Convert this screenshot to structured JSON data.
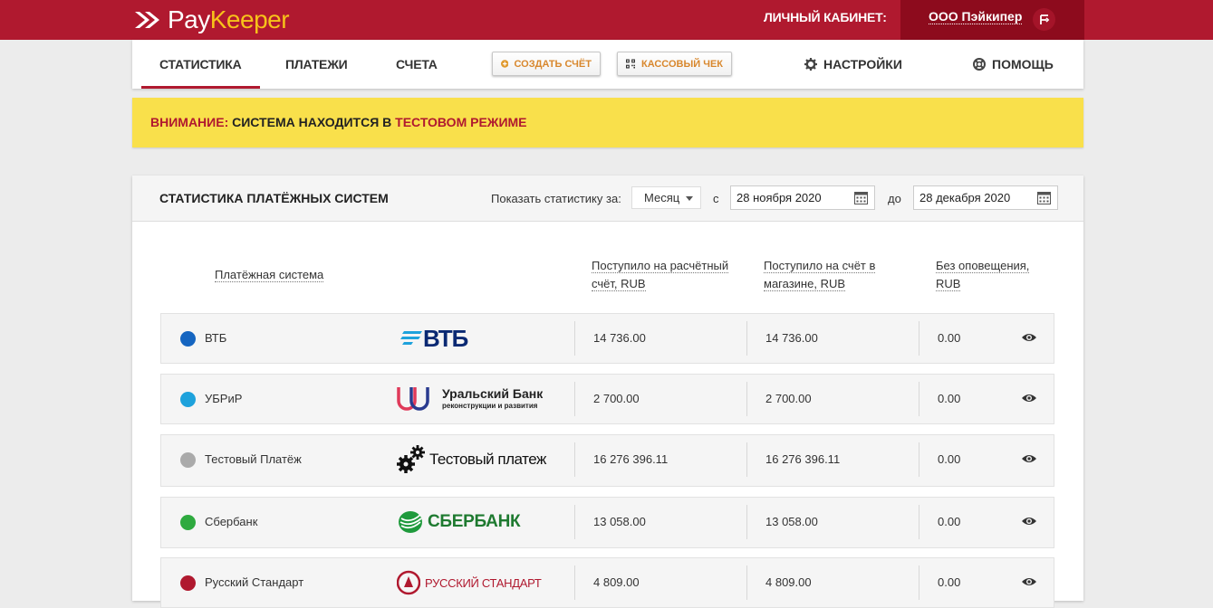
{
  "header": {
    "logo_pay": "Pay",
    "logo_keeper": "Keeper",
    "cabinet_label": "ЛИЧНЫЙ КАБИНЕТ:",
    "account_name": "ООО Пэйкипер"
  },
  "nav": {
    "tabs": [
      {
        "label": "СТАТИСТИКА",
        "active": true
      },
      {
        "label": "ПЛАТЕЖИ",
        "active": false
      },
      {
        "label": "СЧЕТА",
        "active": false
      }
    ],
    "create_invoice": "СОЗДАТЬ СЧЁТ",
    "cash_receipt": "КАССОВЫЙ ЧЕК",
    "settings": "НАСТРОЙКИ",
    "help": "ПОМОЩЬ"
  },
  "alert": {
    "prefix": "ВНИМАНИЕ:",
    "middle": " СИСТЕМА НАХОДИТСЯ В ",
    "mode": "ТЕСТОВОМ РЕЖИМЕ"
  },
  "stats": {
    "title": "СТАТИСТИКА ПЛАТЁЖНЫХ СИСТЕМ",
    "period_label": "Показать статистику за:",
    "period_value": "Месяц",
    "from_label": "с",
    "from_date": "28 ноября 2020",
    "to_label": "до",
    "to_date": "28 декабря 2020",
    "columns": {
      "system": "Платёжная система",
      "received_account_1": "Поступило на расчётный",
      "received_account_2": "счёт, RUB",
      "received_shop_1": "Поступило на счёт в",
      "received_shop_2": "магазине, RUB",
      "no_notify_1": "Без оповещения,",
      "no_notify_2": "RUB"
    },
    "rows": [
      {
        "name": "ВТБ",
        "color": "#1565c0",
        "logo_text": "ВТБ",
        "received_account": "14 736.00",
        "received_shop": "14 736.00",
        "no_notify": "0.00"
      },
      {
        "name": "УБРиР",
        "color": "#1ea2dc",
        "logo_text": "Уральский Банк",
        "logo_sub": "реконструкции и развития",
        "received_account": "2 700.00",
        "received_shop": "2 700.00",
        "no_notify": "0.00"
      },
      {
        "name": "Тестовый Платёж",
        "color": "#aaaaaa",
        "logo_text": "Тестовый платеж",
        "received_account": "16 276 396.11",
        "received_shop": "16 276 396.11",
        "no_notify": "0.00"
      },
      {
        "name": "Сбербанк",
        "color": "#2eaa3f",
        "logo_text": "СБЕРБАНК",
        "received_account": "13 058.00",
        "received_shop": "13 058.00",
        "no_notify": "0.00"
      },
      {
        "name": "Русский Стандарт",
        "color": "#b0192f",
        "logo_text": "РУССКИЙ СТАНДАРТ",
        "received_account": "4 809.00",
        "received_shop": "4 809.00",
        "no_notify": "0.00"
      }
    ]
  },
  "colors": {
    "brand_red": "#b0192f",
    "brand_dark_red": "#8d0b1d",
    "alert_yellow": "#f9e04b",
    "accent_orange": "#d8872d"
  }
}
